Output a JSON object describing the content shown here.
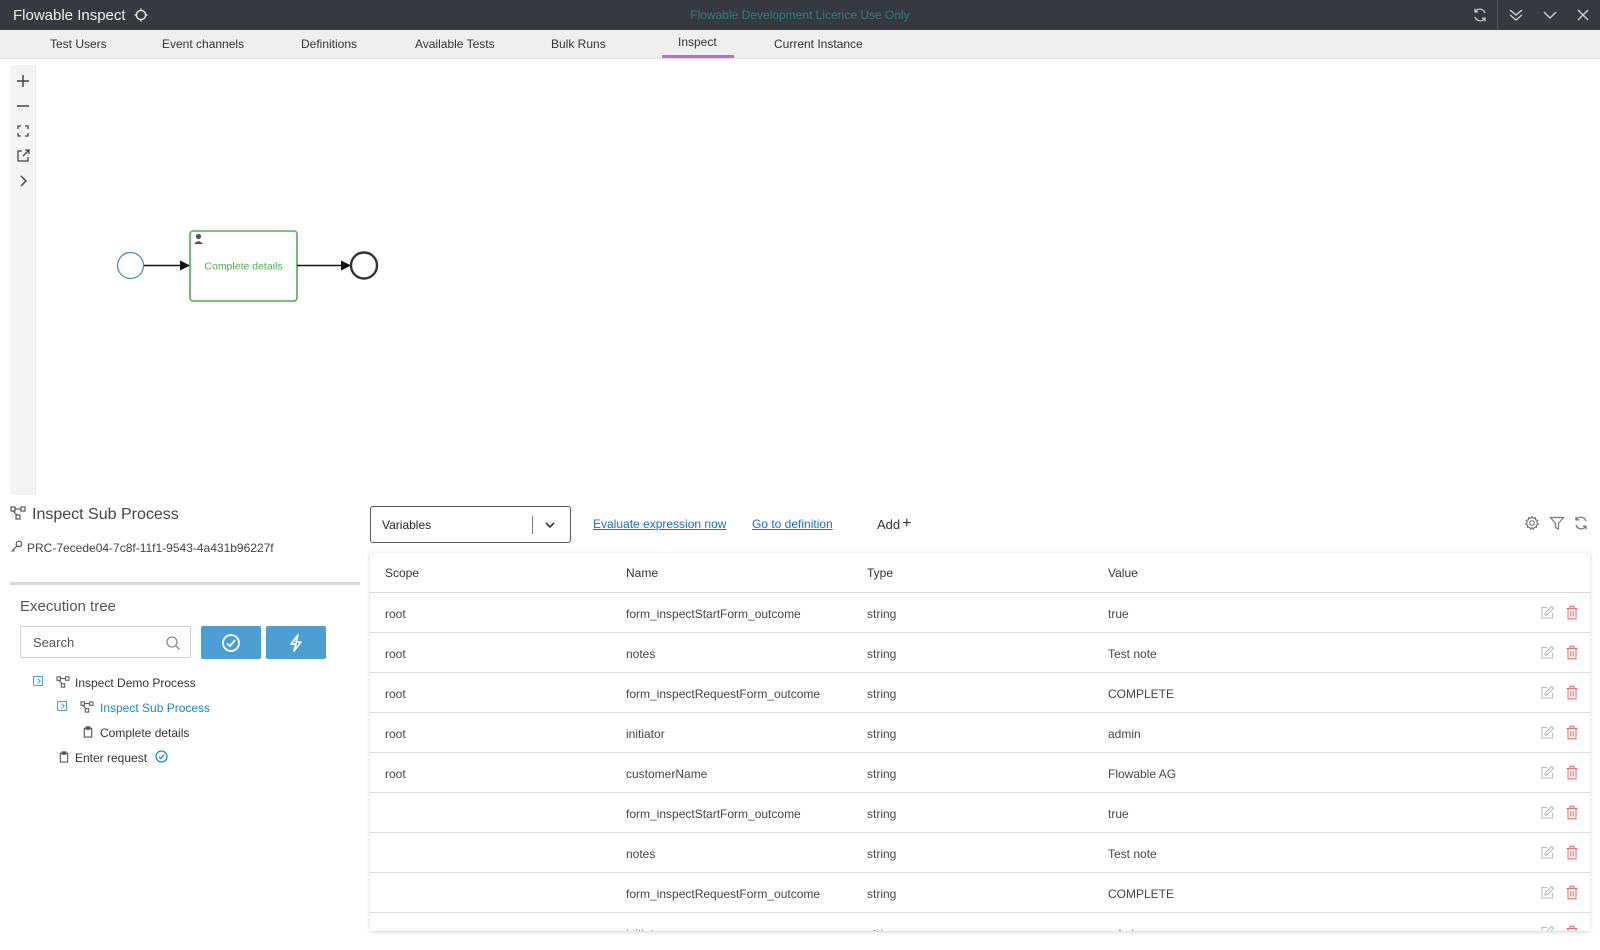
{
  "app": {
    "title": "Flowable Inspect",
    "licence": "Flowable Development Licence Use Only"
  },
  "tabs": [
    {
      "label": "Test Users"
    },
    {
      "label": "Event channels"
    },
    {
      "label": "Definitions"
    },
    {
      "label": "Available Tests"
    },
    {
      "label": "Bulk Runs"
    },
    {
      "label": "Inspect",
      "active": true
    },
    {
      "label": "Current Instance"
    }
  ],
  "diagram": {
    "task_label": "Complete details"
  },
  "process": {
    "title": "Inspect Sub Process",
    "id": "PRC-7ecede04-7c8f-11f1-9543-4a431b96227f"
  },
  "execution_tree": {
    "title": "Execution tree",
    "search_placeholder": "Search",
    "items": [
      {
        "label": "Inspect Demo Process"
      },
      {
        "label": "Inspect Sub Process",
        "selected": true
      },
      {
        "label": "Complete details"
      },
      {
        "label": "Enter request"
      }
    ]
  },
  "toolbar": {
    "view_select": "Variables",
    "evaluate_link": "Evaluate expression now",
    "definition_link": "Go to definition",
    "add_label": "Add"
  },
  "table": {
    "columns": [
      "Scope",
      "Name",
      "Type",
      "Value"
    ],
    "rows": [
      {
        "scope": "root",
        "name": "form_inspectStartForm_outcome",
        "type": "string",
        "value": "true"
      },
      {
        "scope": "root",
        "name": "notes",
        "type": "string",
        "value": "Test note"
      },
      {
        "scope": "root",
        "name": "form_inspectRequestForm_outcome",
        "type": "string",
        "value": "COMPLETE"
      },
      {
        "scope": "root",
        "name": "initiator",
        "type": "string",
        "value": "admin"
      },
      {
        "scope": "root",
        "name": "customerName",
        "type": "string",
        "value": "Flowable AG"
      },
      {
        "scope": "",
        "name": "form_inspectStartForm_outcome",
        "type": "string",
        "value": "true"
      },
      {
        "scope": "",
        "name": "notes",
        "type": "string",
        "value": "Test note"
      },
      {
        "scope": "",
        "name": "form_inspectRequestForm_outcome",
        "type": "string",
        "value": "COMPLETE"
      },
      {
        "scope": "",
        "name": "initiator",
        "type": "string",
        "value": "admin"
      }
    ]
  },
  "colors": {
    "titlebar_bg": "#363a3f",
    "licence_text": "#2e7c84",
    "tab_active_underline": "#b173c7",
    "primary_button": "#4d9fd3",
    "task_green": "#4caf50",
    "delete_red": "#e57373"
  }
}
